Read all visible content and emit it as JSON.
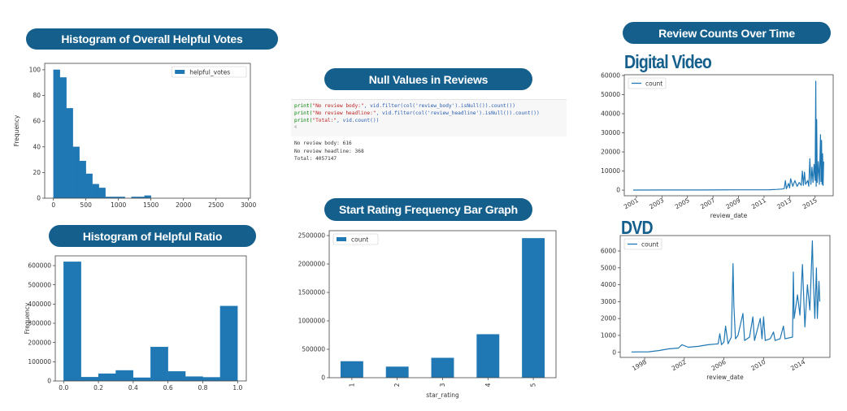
{
  "titles": {
    "helpful_votes": "Histogram of Overall Helpful Votes",
    "helpful_ratio": "Histogram of Helpful Ratio",
    "null_values": "Null Values in Reviews",
    "star_rating": "Start Rating Frequency Bar Graph",
    "review_counts": "Review Counts Over Time",
    "digital_video": "Digital Video",
    "dvd": "DVD"
  },
  "code": {
    "line1": {
      "fn": "print(",
      "str": "\"No review body:\"",
      "rest": ", vid.filter(col('review_body').isNull()).count())"
    },
    "line2": {
      "fn": "print(",
      "str": "\"No review headline:\"",
      "rest": ", vid.filter(col('review_headline').isNull()).count())"
    },
    "line3": {
      "fn": "print(",
      "str": "\"Total:\"",
      "rest": ", vid.count())"
    },
    "indicator": "4",
    "output": [
      "No review body: 616",
      "No review headline: 368",
      "Total: 4057147"
    ]
  },
  "colors": {
    "bar": "#1f77b4",
    "title_pill": "#155f8c",
    "frame": "#555555"
  },
  "chart_data": [
    {
      "id": "helpful_votes",
      "type": "bar",
      "subtype": "histogram",
      "bin_edges": [
        0,
        100,
        200,
        300,
        400,
        500,
        600,
        700,
        800,
        900,
        1000,
        1100,
        1200,
        1300,
        1400,
        1500
      ],
      "values": [
        100,
        94,
        70,
        40,
        29,
        19,
        11,
        8,
        1,
        1,
        1,
        0,
        1,
        1,
        2
      ],
      "legend": [
        "helpful_votes"
      ],
      "legend_position": "top-right",
      "xlabel": "",
      "ylabel": "Frequency",
      "xlim": [
        -134,
        3029
      ],
      "ylim": [
        0,
        105
      ],
      "xticks": [
        0,
        500,
        1000,
        1500,
        2000,
        2500,
        3000
      ],
      "yticks": [
        0,
        20,
        40,
        60,
        80,
        100
      ],
      "grid": false
    },
    {
      "id": "helpful_ratio",
      "type": "bar",
      "subtype": "histogram",
      "bin_edges": [
        0,
        0.1,
        0.2,
        0.3,
        0.4,
        0.5,
        0.6,
        0.7,
        0.8,
        0.9,
        1.0
      ],
      "values": [
        620000,
        20000,
        38000,
        55000,
        17000,
        177000,
        50000,
        23000,
        19000,
        390000
      ],
      "xlabel": "",
      "ylabel": "Frequency",
      "xlim": [
        -0.048,
        1.05
      ],
      "ylim": [
        0,
        650700
      ],
      "xticks": [
        "0.0",
        "0.2",
        "0.4",
        "0.6",
        "0.8",
        "1.0"
      ],
      "yticks": [
        0,
        100000,
        200000,
        300000,
        400000,
        500000,
        600000
      ],
      "grid": false
    },
    {
      "id": "star_rating",
      "type": "bar",
      "categories": [
        "1",
        "2",
        "3",
        "4",
        "5"
      ],
      "values": [
        290000,
        195000,
        350000,
        765000,
        2455000
      ],
      "legend": [
        "count"
      ],
      "legend_position": "top-left",
      "xlabel": "star_rating",
      "ylabel": "",
      "ylim": [
        0,
        2586000
      ],
      "yticks": [
        0,
        500000,
        1000000,
        1500000,
        2000000,
        2500000
      ],
      "grid": false
    },
    {
      "id": "digital_video",
      "type": "line",
      "legend": [
        "count"
      ],
      "legend_position": "top-left",
      "xlabel": "review_date",
      "ylabel": "",
      "xlim": [
        "2000-01-20",
        "2016-05-30"
      ],
      "ylim": [
        -2937,
        60420
      ],
      "xticks": [
        "2001",
        "2003",
        "2005",
        "2007",
        "2009",
        "2011",
        "2013",
        "2015"
      ],
      "yticks": [
        0,
        10000,
        20000,
        30000,
        40000,
        50000,
        60000
      ],
      "x": [
        "2000-10",
        "2003-01",
        "2006-01",
        "2009-01",
        "2011-06",
        "2012-01",
        "2012-06",
        "2012-08",
        "2012-09",
        "2012-10",
        "2012-12",
        "2013-01",
        "2013-02",
        "2013-04",
        "2013-06",
        "2013-08",
        "2013-10",
        "2013-12",
        "2014-01",
        "2014-02",
        "2014-03",
        "2014-04",
        "2014-06",
        "2014-07",
        "2014-08",
        "2014-09",
        "2014-10",
        "2014-11",
        "2014-12",
        "2015-01",
        "2015-01-20",
        "2015-02",
        "2015-02-15",
        "2015-03",
        "2015-04",
        "2015-05",
        "2015-06",
        "2015-06-15",
        "2015-07",
        "2015-07-15",
        "2015-08",
        "2015-08-15",
        "2015-08-31"
      ],
      "y": [
        50,
        80,
        100,
        150,
        200,
        400,
        600,
        800,
        5000,
        700,
        3500,
        1200,
        6000,
        2000,
        5000,
        2000,
        4000,
        2500,
        10000,
        2500,
        9500,
        3000,
        5000,
        2000,
        16500,
        3000,
        12000,
        4000,
        13500,
        5000,
        57000,
        2000,
        37000,
        4000,
        15000,
        3000,
        29000,
        4500,
        26000,
        3000,
        19000,
        2500,
        15000
      ]
    },
    {
      "id": "dvd",
      "type": "line",
      "legend": [
        "count"
      ],
      "legend_position": "top-left",
      "xlabel": "review_date",
      "ylabel": "",
      "xlim": [
        "1995-07-15",
        "2016-09-10"
      ],
      "ylim": [
        -303,
        6915
      ],
      "xticks": [
        "1998",
        "2002",
        "2006",
        "2010",
        "2014"
      ],
      "yticks": [
        0,
        1000,
        2000,
        3000,
        4000,
        5000,
        6000
      ],
      "x": [
        "1996-09",
        "1998-06",
        "1999-06",
        "2000-06",
        "2001-06",
        "2001-10",
        "2002-06",
        "2003-06",
        "2004-06",
        "2005-06",
        "2005-08",
        "2005-10",
        "2006-01",
        "2006-03",
        "2006-06",
        "2006-10",
        "2006-12",
        "2007-01",
        "2007-03",
        "2007-06",
        "2007-12",
        "2008-02",
        "2008-08",
        "2008-12",
        "2009-02",
        "2009-09",
        "2009-11",
        "2010-01",
        "2010-03",
        "2010-09",
        "2011-01",
        "2011-03",
        "2011-09",
        "2012-01",
        "2012-03",
        "2012-12",
        "2013-01",
        "2013-02",
        "2013-06",
        "2013-09",
        "2013-12",
        "2014-03",
        "2014-06",
        "2014-09",
        "2014-12",
        "2015-01",
        "2015-03",
        "2015-05",
        "2015-06",
        "2015-08",
        "2015-08-31"
      ],
      "y": [
        20,
        30,
        100,
        200,
        250,
        450,
        300,
        350,
        450,
        500,
        1100,
        450,
        600,
        1550,
        500,
        900,
        5250,
        2800,
        800,
        1000,
        2300,
        700,
        900,
        2100,
        700,
        2000,
        800,
        2100,
        700,
        800,
        1200,
        700,
        800,
        1550,
        800,
        900,
        4750,
        2000,
        3400,
        2200,
        5200,
        1500,
        4000,
        2500,
        6600,
        4500,
        2000,
        5000,
        2000,
        4200,
        3000
      ]
    }
  ]
}
